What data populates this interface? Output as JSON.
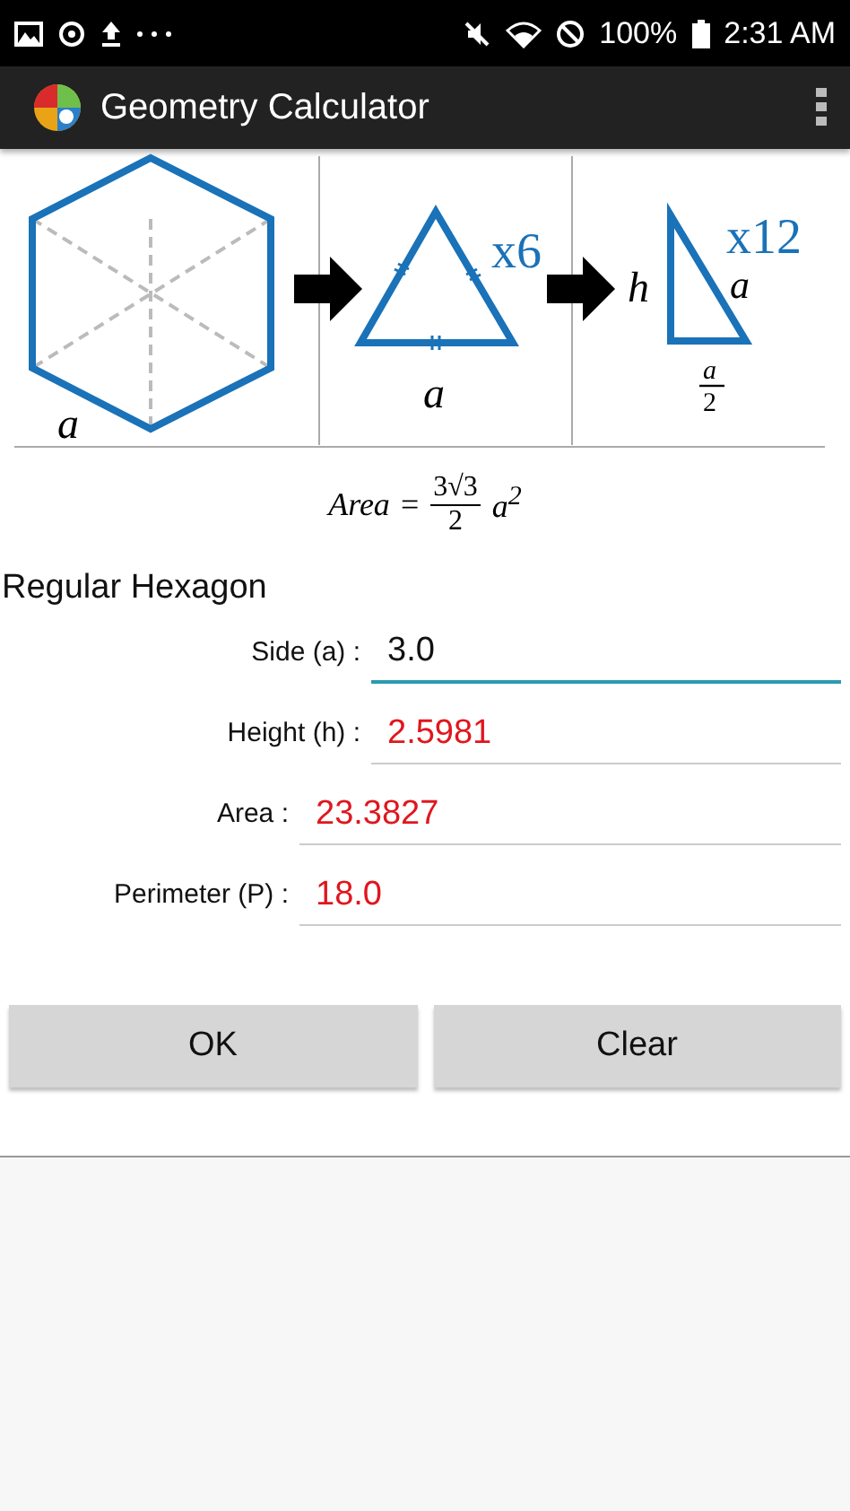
{
  "status_bar": {
    "battery": "100%",
    "time": "2:31 AM"
  },
  "app_bar": {
    "title": "Geometry Calculator"
  },
  "diagram": {
    "hexagon_side": "a",
    "triangle_count": "x6",
    "triangle_side": "a",
    "height_label": "h",
    "right_count": "x12",
    "hypotenuse": "a",
    "base_numerator": "a",
    "base_denominator": "2"
  },
  "formula": {
    "lhs": "Area",
    "equals": "=",
    "numerator": "3√3",
    "denominator": "2",
    "factor": "a$^{2}$"
  },
  "shape_title": "Regular Hexagon",
  "fields": [
    {
      "label": "Side (a) :",
      "value": "3.0",
      "kind": "input",
      "focused": true
    },
    {
      "label": "Height (h) :",
      "value": "2.5981",
      "kind": "output",
      "focused": false
    },
    {
      "label": "Area :",
      "value": "23.3827",
      "kind": "output",
      "focused": false
    },
    {
      "label": "Perimeter (P) :",
      "value": "18.0",
      "kind": "output",
      "focused": false
    }
  ],
  "buttons": [
    "OK",
    "Clear"
  ]
}
